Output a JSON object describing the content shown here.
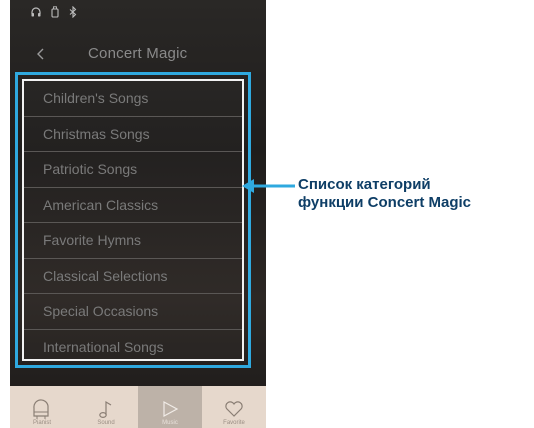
{
  "header": {
    "title": "Concert Magic"
  },
  "status_icons": [
    "headphones-icon",
    "usb-icon",
    "bluetooth-icon"
  ],
  "list": {
    "items": [
      {
        "label": "Children's Songs"
      },
      {
        "label": "Christmas Songs"
      },
      {
        "label": "Patriotic Songs"
      },
      {
        "label": "American Classics"
      },
      {
        "label": "Favorite Hymns"
      },
      {
        "label": "Classical Selections"
      },
      {
        "label": "Special Occasions"
      },
      {
        "label": "International Songs"
      }
    ]
  },
  "tabs": [
    {
      "label": "Pianist",
      "icon": "piano-icon",
      "active": false
    },
    {
      "label": "Sound",
      "icon": "music-note-icon",
      "active": false
    },
    {
      "label": "Music",
      "icon": "play-icon",
      "active": true
    },
    {
      "label": "Favorite",
      "icon": "heart-icon",
      "active": false
    }
  ],
  "callout": {
    "line1": "Список категорий",
    "line2": "функции Concert Magic"
  },
  "colors": {
    "highlight": "#2fa9df",
    "callout_text": "#0e3e66",
    "tab_bar": "#e6d8cc",
    "tab_active": "#bdb2a8"
  }
}
